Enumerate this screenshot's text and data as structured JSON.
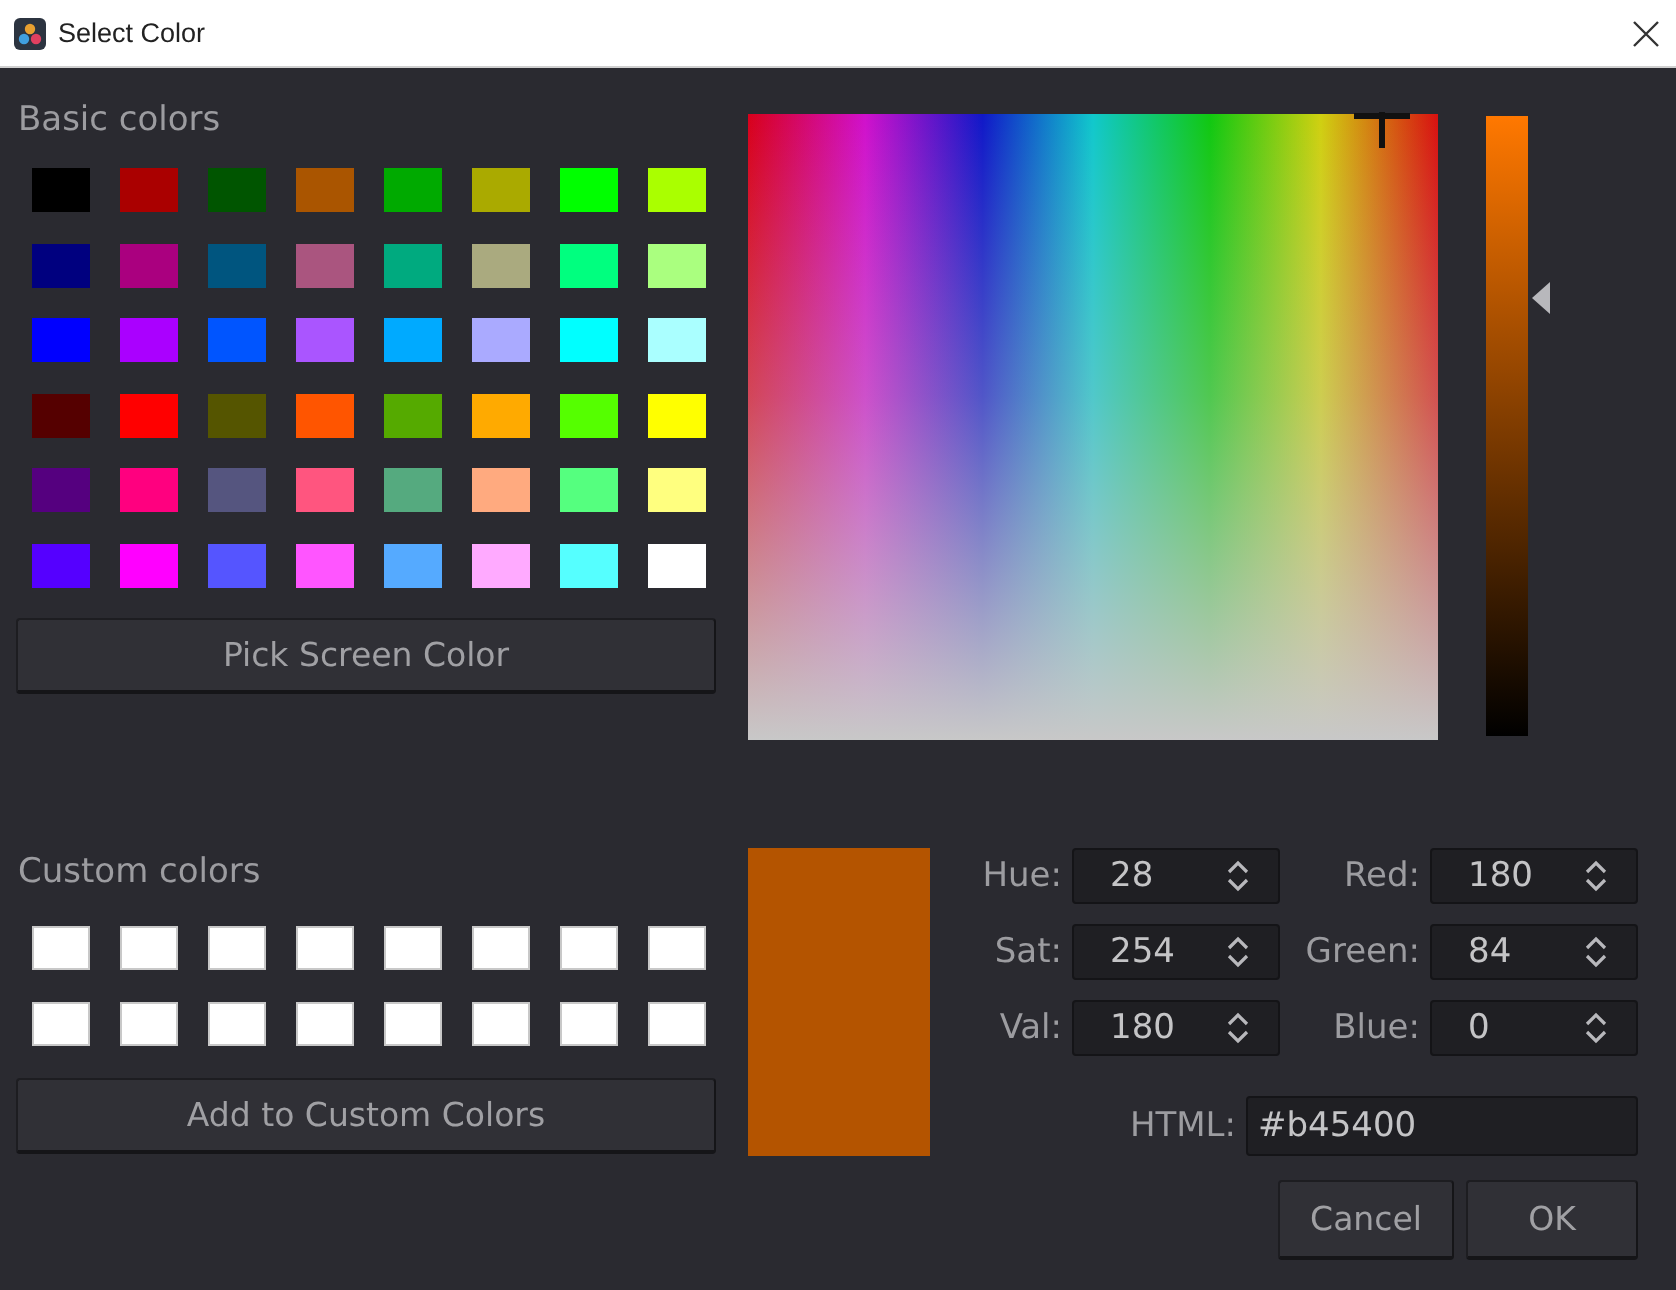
{
  "window": {
    "title": "Select Color"
  },
  "basic_colors": {
    "label": "Basic colors",
    "swatches": [
      {
        "color": "#000000"
      },
      {
        "color": "#aa0000"
      },
      {
        "color": "#005500"
      },
      {
        "color": "#aa5500"
      },
      {
        "color": "#00aa00"
      },
      {
        "color": "#aaaa00"
      },
      {
        "color": "#00ff00"
      },
      {
        "color": "#aaff00"
      },
      {
        "color": "#00007f"
      },
      {
        "color": "#aa007f"
      },
      {
        "color": "#00557f"
      },
      {
        "color": "#aa557f"
      },
      {
        "color": "#00aa7f"
      },
      {
        "color": "#aaaa7f"
      },
      {
        "color": "#00ff7f"
      },
      {
        "color": "#aaff7f"
      },
      {
        "color": "#0000ff"
      },
      {
        "color": "#aa00ff"
      },
      {
        "color": "#0055ff"
      },
      {
        "color": "#aa55ff"
      },
      {
        "color": "#00aaff"
      },
      {
        "color": "#aaaaff"
      },
      {
        "color": "#00ffff"
      },
      {
        "color": "#aaffff"
      },
      {
        "color": "#550000"
      },
      {
        "color": "#ff0000"
      },
      {
        "color": "#555500"
      },
      {
        "color": "#ff5500"
      },
      {
        "color": "#55aa00"
      },
      {
        "color": "#ffaa00"
      },
      {
        "color": "#55ff00"
      },
      {
        "color": "#ffff00"
      },
      {
        "color": "#55007f"
      },
      {
        "color": "#ff007f"
      },
      {
        "color": "#55557f"
      },
      {
        "color": "#ff557f"
      },
      {
        "color": "#55aa7f"
      },
      {
        "color": "#ffaa7f"
      },
      {
        "color": "#55ff7f"
      },
      {
        "color": "#ffff7f"
      },
      {
        "color": "#5500ff"
      },
      {
        "color": "#ff00ff"
      },
      {
        "color": "#5555ff"
      },
      {
        "color": "#ff55ff"
      },
      {
        "color": "#55aaff"
      },
      {
        "color": "#ffaaff"
      },
      {
        "color": "#55ffff"
      },
      {
        "color": "#ffffff"
      }
    ],
    "button": "Pick Screen Color"
  },
  "custom_colors": {
    "label": "Custom colors",
    "swatches": [
      {
        "color": "#ffffff"
      },
      {
        "color": "#ffffff"
      },
      {
        "color": "#ffffff"
      },
      {
        "color": "#ffffff"
      },
      {
        "color": "#ffffff"
      },
      {
        "color": "#ffffff"
      },
      {
        "color": "#ffffff"
      },
      {
        "color": "#ffffff"
      },
      {
        "color": "#ffffff"
      },
      {
        "color": "#ffffff"
      },
      {
        "color": "#ffffff"
      },
      {
        "color": "#ffffff"
      },
      {
        "color": "#ffffff"
      },
      {
        "color": "#ffffff"
      },
      {
        "color": "#ffffff"
      },
      {
        "color": "#ffffff"
      }
    ],
    "button": "Add to Custom Colors"
  },
  "value_slider": {
    "level": 0.706
  },
  "preview": {
    "color": "#b45400"
  },
  "hsv_fields": [
    {
      "label": "Hue:",
      "value": "28"
    },
    {
      "label": "Sat:",
      "value": "254"
    },
    {
      "label": "Val:",
      "value": "180"
    }
  ],
  "rgb_fields": [
    {
      "label": "Red:",
      "value": "180"
    },
    {
      "label": "Green:",
      "value": "84"
    },
    {
      "label": "Blue:",
      "value": "0"
    }
  ],
  "html_field": {
    "label": "HTML:",
    "value": "#b45400"
  },
  "dialog_buttons": [
    "Cancel",
    "OK"
  ]
}
